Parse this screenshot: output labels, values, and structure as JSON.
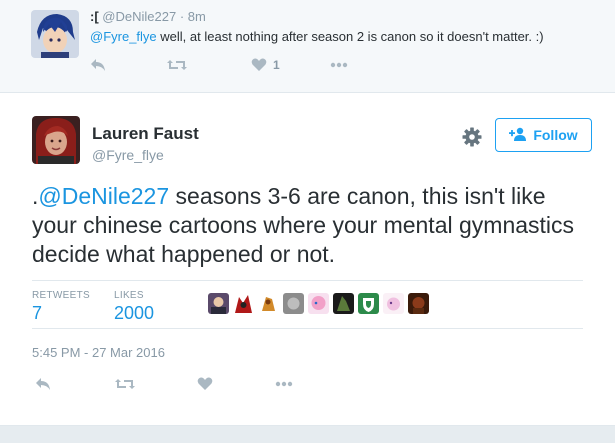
{
  "reply": {
    "name": ":[",
    "handle": "@DeNile227",
    "separator": "·",
    "time": "8m",
    "mention": "@Fyre_flye",
    "text": " well, at least nothing after season 2 is canon so it doesn't matter. :)",
    "like_count": "1"
  },
  "tweet": {
    "name": "Lauren Faust",
    "handle": "@Fyre_flye",
    "follow_label": "Follow",
    "text_prefix": ".",
    "mention": "@DeNile227",
    "text": " seasons 3-6 are canon, this isn't like your chinese cartoons where your mental gymnastics decide what happened or not.",
    "retweets_label": "RETWEETS",
    "retweets_value": "7",
    "likes_label": "LIKES",
    "likes_value": "2000",
    "timestamp": "5:45 PM - 27 Mar 2016"
  },
  "icons": {
    "reply": "reply-icon",
    "retweet": "retweet-icon",
    "like": "heart-icon",
    "more": "more-icon",
    "gear": "gear-icon",
    "follow": "add-user-icon"
  },
  "colors": {
    "link": "#1b95e0",
    "brand": "#1da1f2",
    "muted": "#8899a6",
    "icon": "#aab8c2",
    "reply_bg": "#f5f8fa"
  },
  "liker_avatar_colors": [
    "#5a4a6a",
    "#b01818",
    "#d28a2a",
    "#8c8c8c",
    "#f2a0c8",
    "#5a7a3a",
    "#2c8a4a",
    "#f0c0e0",
    "#8a3a1a"
  ]
}
